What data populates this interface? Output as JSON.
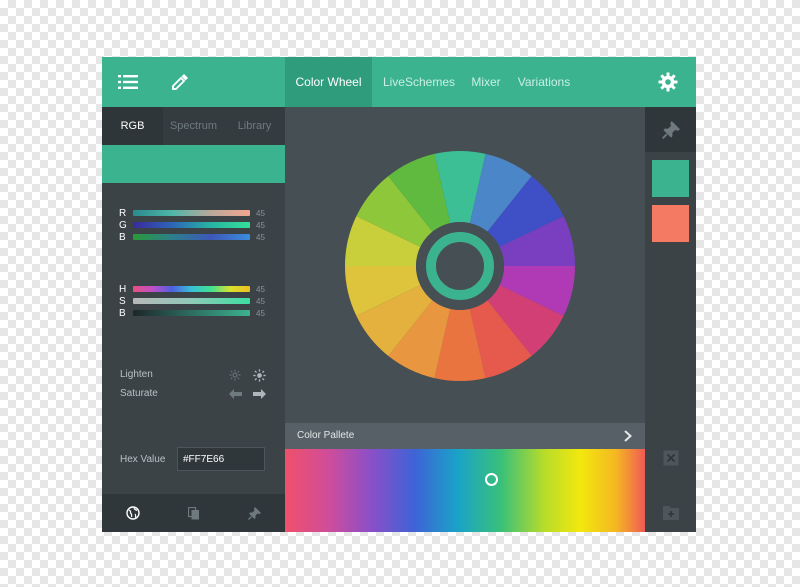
{
  "left_panel": {
    "tabs": [
      {
        "label": "RGB"
      },
      {
        "label": "Spectrum"
      },
      {
        "label": "Library"
      }
    ],
    "rgb": [
      {
        "label": "R",
        "value": "45"
      },
      {
        "label": "G",
        "value": "45"
      },
      {
        "label": "B",
        "value": "45"
      }
    ],
    "hsb": [
      {
        "label": "H",
        "value": "45"
      },
      {
        "label": "S",
        "value": "45"
      },
      {
        "label": "B",
        "value": "45"
      }
    ],
    "lighten_label": "Lighten",
    "saturate_label": "Saturate",
    "hex_label": "Hex Value",
    "hex_value": "#FF7E66"
  },
  "header": {
    "tabs": [
      {
        "label": "Color Wheel"
      },
      {
        "label": "LiveSchemes"
      },
      {
        "label": "Mixer"
      },
      {
        "label": "Variations"
      }
    ]
  },
  "palette": {
    "label": "Color Pallete"
  },
  "icons": {
    "menu": "menu-icon",
    "eyedropper": "eyedropper-icon",
    "gear": "gear-icon",
    "globe": "globe-icon",
    "copy": "copy-icon",
    "pin": "pin-icon",
    "close": "close-icon",
    "add_folder": "add-folder-icon",
    "chevron": "chevron-right-icon"
  },
  "colors": {
    "accent": "#3cb38f",
    "swatch_1": "#3cb38f",
    "swatch_2": "#f47a63",
    "wheel_segments": [
      "#3cbf94",
      "#4a86c8",
      "#3f4fc5",
      "#7a3fc0",
      "#b03ab5",
      "#d13f75",
      "#e55a4d",
      "#ea7440",
      "#e89640",
      "#e4b13f",
      "#dec33d",
      "#c9cf3a",
      "#8fc73b",
      "#5fba3f"
    ]
  }
}
